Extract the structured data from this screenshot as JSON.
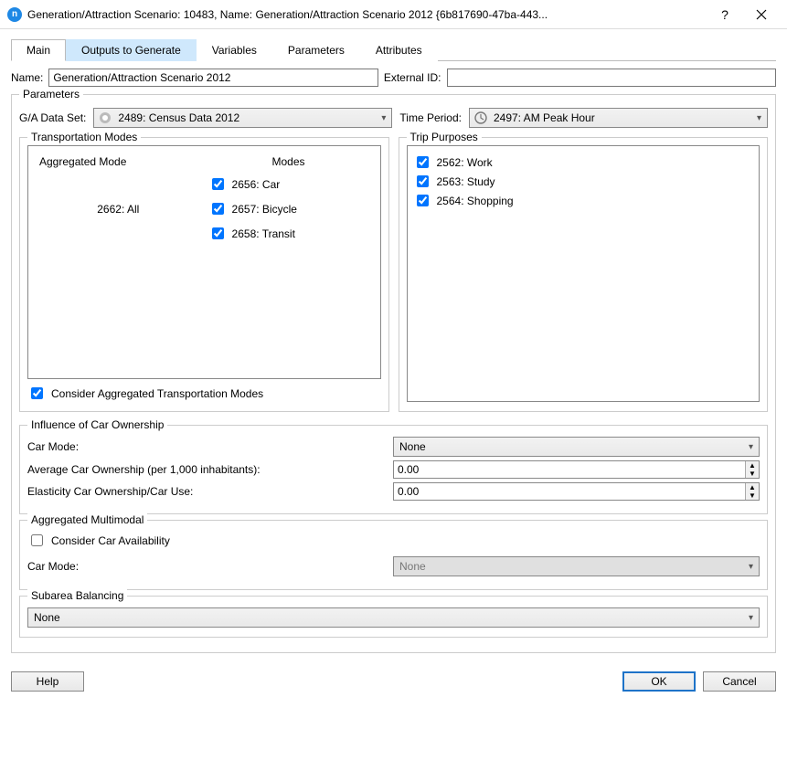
{
  "window": {
    "title": "Generation/Attraction Scenario: 10483, Name: Generation/Attraction Scenario 2012  {6b817690-47ba-443..."
  },
  "tabs": [
    {
      "label": "Main",
      "state": "active"
    },
    {
      "label": "Outputs to Generate",
      "state": "highlight"
    },
    {
      "label": "Variables",
      "state": ""
    },
    {
      "label": "Parameters",
      "state": ""
    },
    {
      "label": "Attributes",
      "state": ""
    }
  ],
  "nameRow": {
    "label": "Name:",
    "value": "Generation/Attraction Scenario 2012",
    "extIdLabel": "External ID:",
    "extIdValue": ""
  },
  "parameters": {
    "legend": "Parameters",
    "dataSetLabel": "G/A Data Set:",
    "dataSetValue": "2489: Census Data 2012",
    "timePeriodLabel": "Time Period:",
    "timePeriodValue": "2497: AM Peak Hour",
    "transportation": {
      "legend": "Transportation Modes",
      "headerAgg": "Aggregated Mode",
      "headerModes": "Modes",
      "aggLabel": "2662: All",
      "modes": [
        {
          "label": "2656: Car",
          "checked": true
        },
        {
          "label": "2657: Bicycle",
          "checked": true
        },
        {
          "label": "2658: Transit",
          "checked": true
        }
      ],
      "considerLabel": "Consider Aggregated Transportation Modes",
      "considerChecked": true
    },
    "tripPurposes": {
      "legend": "Trip Purposes",
      "items": [
        {
          "label": "2562: Work",
          "checked": true
        },
        {
          "label": "2563: Study",
          "checked": true
        },
        {
          "label": "2564: Shopping",
          "checked": true
        }
      ]
    },
    "carOwnership": {
      "legend": "Influence of Car Ownership",
      "carModeLabel": "Car Mode:",
      "carModeValue": "None",
      "avgLabel": "Average Car Ownership (per 1,000 inhabitants):",
      "avgValue": "0.00",
      "elasticityLabel": "Elasticity Car Ownership/Car Use:",
      "elasticityValue": "0.00"
    },
    "aggMultimodal": {
      "legend": "Aggregated Multimodal",
      "considerLabel": "Consider Car Availability",
      "considerChecked": false,
      "carModeLabel": "Car Mode:",
      "carModeValue": "None"
    },
    "subarea": {
      "legend": "Subarea Balancing",
      "value": "None"
    }
  },
  "footer": {
    "help": "Help",
    "ok": "OK",
    "cancel": "Cancel"
  }
}
